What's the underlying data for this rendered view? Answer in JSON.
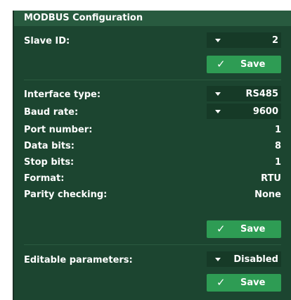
{
  "section": {
    "title": "MODBUS Configuration"
  },
  "slave": {
    "label": "Slave ID:",
    "value": "2",
    "save_label": "Save",
    "save_icon": "✓"
  },
  "interface": {
    "interface_type": {
      "label": "Interface type:",
      "value": "RS485"
    },
    "baud_rate": {
      "label": "Baud rate:",
      "value": "9600"
    },
    "port_number": {
      "label": "Port number:",
      "value": "1"
    },
    "data_bits": {
      "label": "Data bits:",
      "value": "8"
    },
    "stop_bits": {
      "label": "Stop bits:",
      "value": "1"
    },
    "format": {
      "label": "Format:",
      "value": "RTU"
    },
    "parity": {
      "label": "Parity checking:",
      "value": "None"
    },
    "save_label": "Save",
    "save_icon": "✓"
  },
  "editable": {
    "label": "Editable parameters:",
    "value": "Disabled",
    "save_label": "Save",
    "save_icon": "✓"
  },
  "colors": {
    "panel_bg": "#1c4530",
    "title_bg": "#285a3f",
    "select_bg": "#163a27",
    "button_bg": "#2e9c54",
    "text": "#ffffff"
  }
}
